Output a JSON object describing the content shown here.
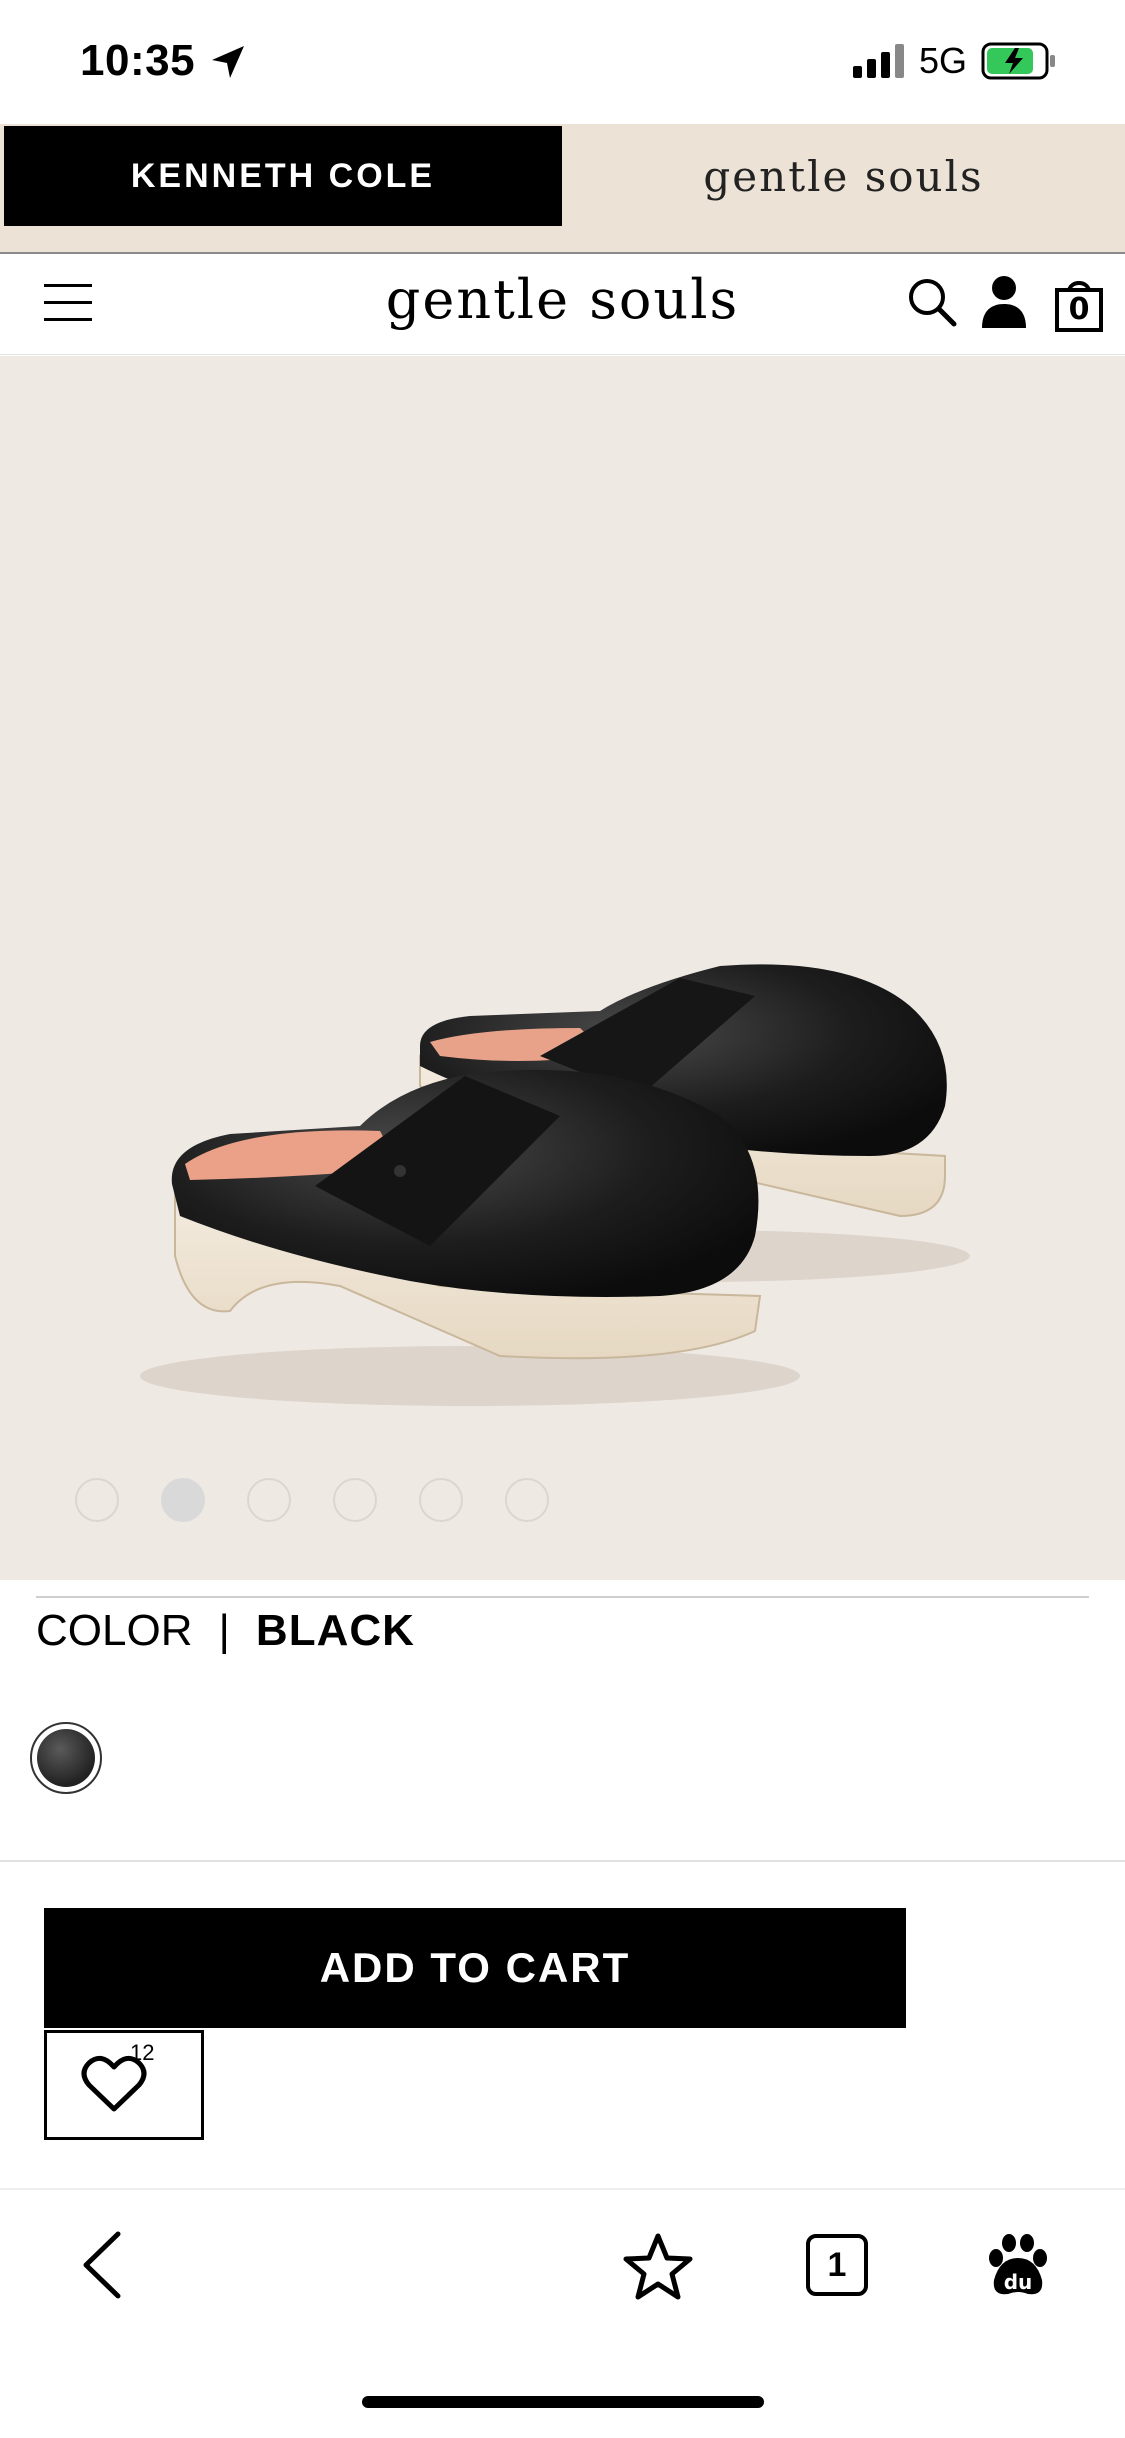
{
  "status_bar": {
    "time": "10:35",
    "network": "5G"
  },
  "brand_switch": {
    "primary": "KENNETH COLE",
    "secondary": "gentle souls"
  },
  "header": {
    "logo": "gentle souls",
    "cart_count": "0"
  },
  "carousel": {
    "slides": 6,
    "active_index": 1
  },
  "product": {
    "color_label": "COLOR",
    "color_separator": "|",
    "color_value": "BLACK",
    "add_to_cart": "ADD TO CART",
    "wishlist_count": "12"
  },
  "browser_bar": {
    "tab_count": "1"
  },
  "icons": [
    "location-arrow-icon",
    "signal-icon",
    "battery-icon",
    "menu-icon",
    "search-icon",
    "account-icon",
    "cart-icon",
    "heart-icon",
    "back-icon",
    "star-icon",
    "tabs-icon",
    "paw-icon"
  ]
}
